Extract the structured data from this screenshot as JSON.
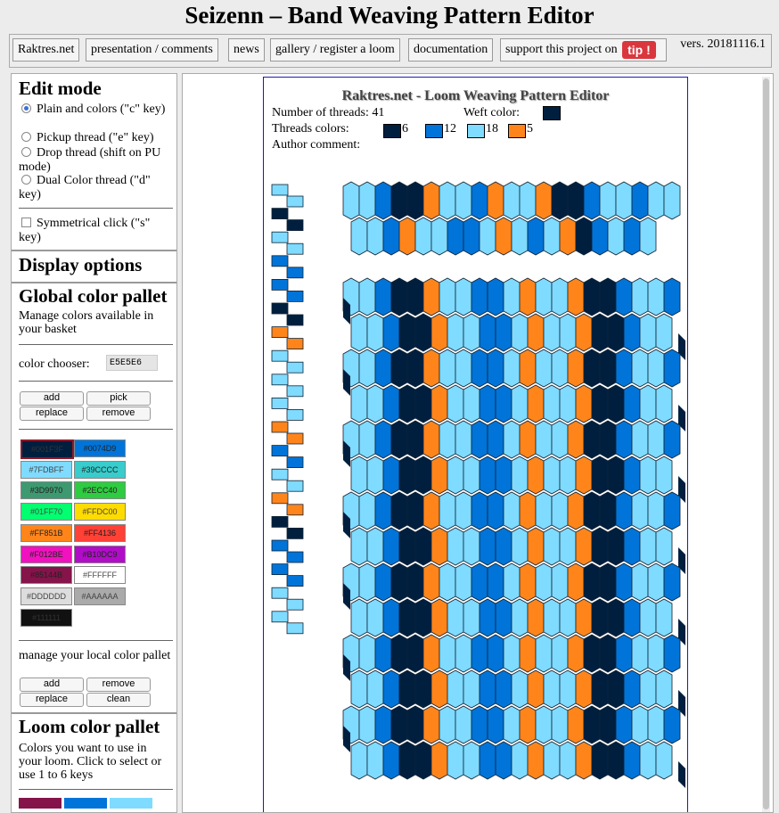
{
  "header": {
    "title": "Seizenn – Band Weaving Pattern Editor"
  },
  "nav": {
    "items": [
      "Raktres.net",
      "presentation / comments",
      "news",
      "gallery / register a loom",
      "documentation",
      "support this project on"
    ],
    "tip_label": "tip !",
    "version": "vers. 20181116.1"
  },
  "sidebar": {
    "edit_mode": {
      "heading": "Edit mode",
      "options": [
        "Plain and colors (\"c\" key)",
        "Pickup thread (\"e\" key)",
        "Drop thread (shift on PU mode)",
        "Dual Color thread (\"d\" key)"
      ],
      "selected": 0,
      "symmetric_label": "Symmetrical click (\"s\" key)"
    },
    "display_options": {
      "heading": "Display options"
    },
    "global_pallet": {
      "heading": "Global color pallet",
      "description": "Manage colors available in your basket",
      "chooser_label": "color chooser:",
      "chooser_value": "E5E5E6",
      "buttons": {
        "add": "add",
        "pick": "pick",
        "replace": "replace",
        "remove": "remove"
      },
      "swatches": [
        "#001F3F",
        "#0074D9",
        "#7FDBFF",
        "#39CCCC",
        "#3D9970",
        "#2ECC40",
        "#01FF70",
        "#FFDC00",
        "#FF851B",
        "#FF4136",
        "#F012BE",
        "#B10DC9",
        "#85144B",
        "#FFFFFF",
        "#DDDDDD",
        "#AAAAAA",
        "#111111"
      ],
      "local_label": "manage your local color pallet",
      "local_buttons": {
        "add": "add",
        "remove": "remove",
        "replace": "replace",
        "clean": "clean"
      }
    },
    "loom_pallet": {
      "heading": "Loom color pallet",
      "description": "Colors you want to use in your loom. Click to select or use 1 to 6 keys"
    }
  },
  "editor": {
    "title": "Raktres.net - Loom Weaving Pattern Editor",
    "threads_label": "Number of threads:",
    "threads_count": "41",
    "weft_label": "Weft color:",
    "weft_color": "#001F3F",
    "thread_colors_label": "Threads colors:",
    "thread_colors": [
      {
        "color": "#001F3F",
        "count": "6"
      },
      {
        "color": "#0074D9",
        "count": "12"
      },
      {
        "color": "#7FDBFF",
        "count": "18"
      },
      {
        "color": "#FF851B",
        "count": "5"
      }
    ],
    "author_label": "Author comment:",
    "author_comment": "",
    "threading_top": [
      2,
      2,
      1,
      0,
      0,
      3,
      2,
      2,
      1,
      3,
      2,
      2,
      3,
      0,
      0,
      1,
      2,
      2,
      1,
      2,
      2
    ],
    "threading_bottom": [
      2,
      1,
      0,
      3,
      2,
      2,
      1,
      1,
      2,
      3,
      0,
      1,
      2,
      2
    ],
    "heddle_left": [
      2,
      0,
      2,
      1,
      1,
      0,
      3,
      2,
      2,
      2,
      3,
      1,
      2,
      3,
      0,
      1,
      1,
      2,
      2
    ]
  }
}
